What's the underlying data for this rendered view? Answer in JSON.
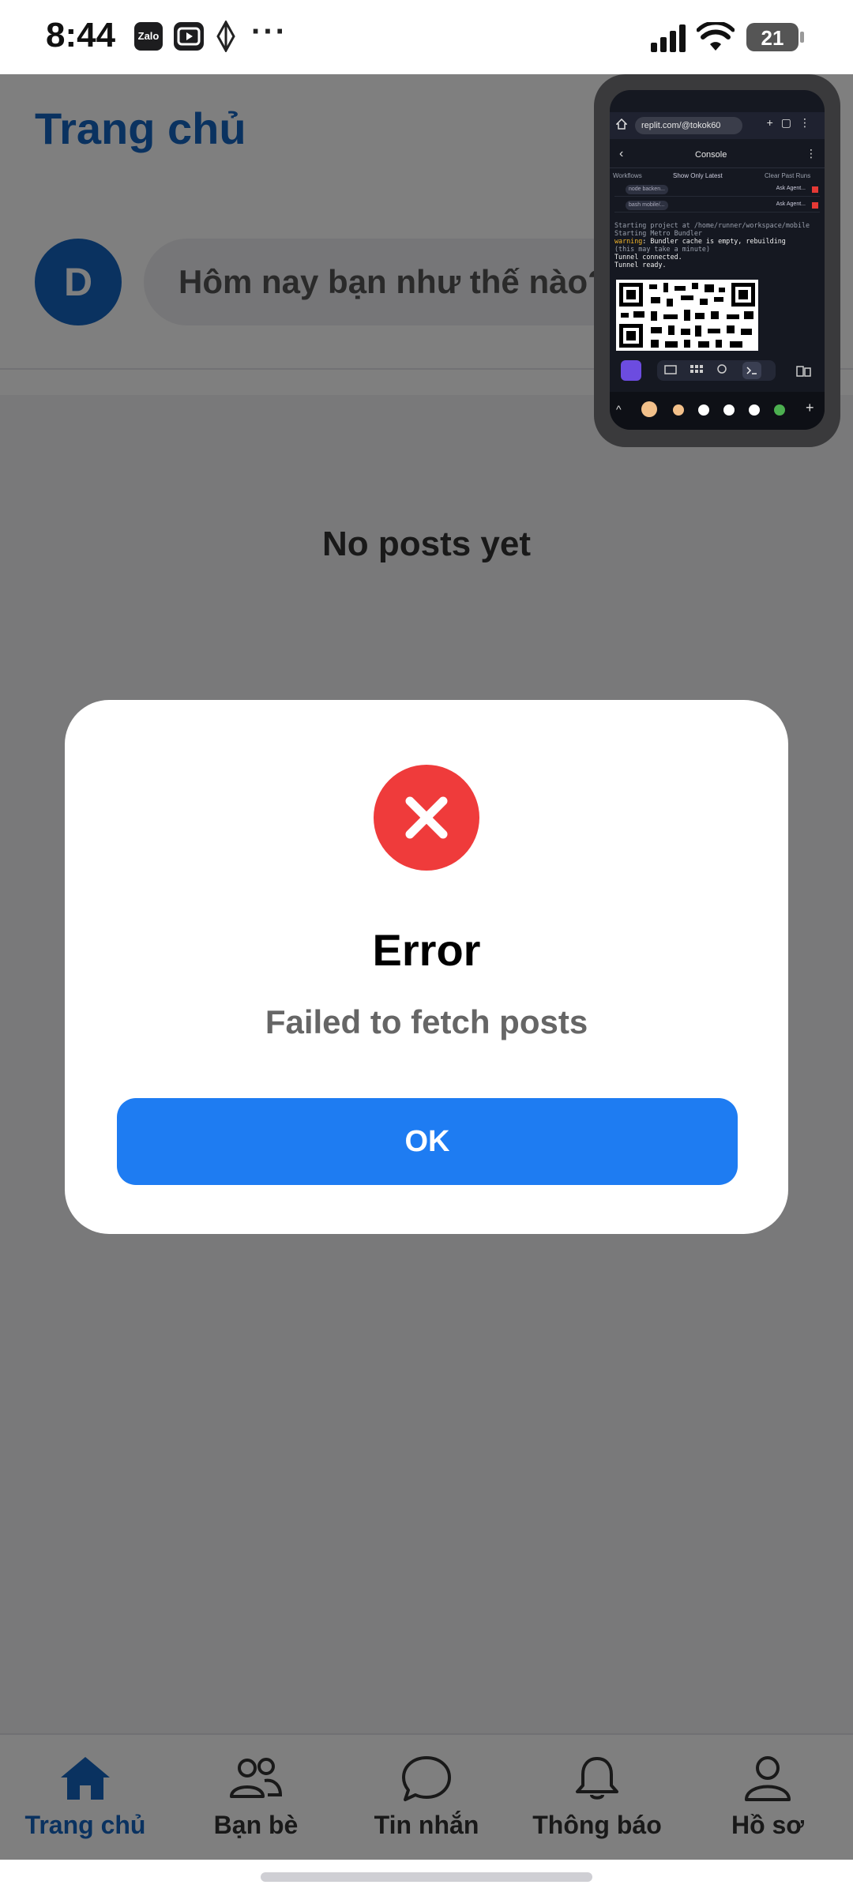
{
  "status_bar": {
    "time": "8:44",
    "app_badges": [
      "Zalo",
      "video-icon",
      "diamond-icon"
    ],
    "more": "···",
    "battery": "21",
    "icons": [
      "signal-icon",
      "wifi-icon",
      "battery-icon"
    ]
  },
  "header": {
    "title": "Trang chủ"
  },
  "composer": {
    "avatar_initial": "D",
    "placeholder": "Hôm nay bạn như thế nào?"
  },
  "feed": {
    "empty_text": "No posts yet"
  },
  "dialog": {
    "icon": "error-x-icon",
    "title": "Error",
    "message": "Failed to fetch posts",
    "ok_label": "OK",
    "accent_color": "#1e7cf2",
    "error_color": "#ef3b3b"
  },
  "tabs": [
    {
      "label": "Trang chủ",
      "icon": "home-icon",
      "active": true
    },
    {
      "label": "Bạn bè",
      "icon": "friends-icon",
      "active": false
    },
    {
      "label": "Tin nhắn",
      "icon": "chat-icon",
      "active": false
    },
    {
      "label": "Thông báo",
      "icon": "bell-icon",
      "active": false
    },
    {
      "label": "Hồ sơ",
      "icon": "profile-icon",
      "active": false
    }
  ],
  "pip": {
    "url": "replit.com/@tokok60",
    "console_title": "Console",
    "workflows_label": "Workflows",
    "show_only_latest": "Show Only Latest",
    "clear_past_runs": "Clear Past Runs",
    "rows": [
      {
        "name": "node backen...",
        "agent": "Ask Agent..."
      },
      {
        "name": "bash mobile/...",
        "agent": "Ask Agent..."
      }
    ],
    "log": {
      "line1": "Starting project at /home/runner/workspace/mobile",
      "line2": "Starting Metro Bundler",
      "warn_label": "warning",
      "warn_text": ": Bundler cache is empty, rebuilding",
      "line3": "(this may take a minute)",
      "line4": "Tunnel connected.",
      "line5": "Tunnel ready."
    }
  }
}
